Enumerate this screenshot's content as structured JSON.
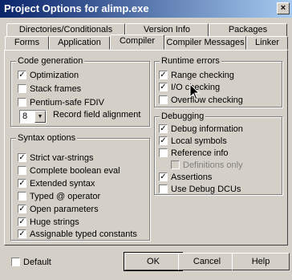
{
  "window": {
    "title": "Project Options for alimp.exe",
    "close_glyph": "×"
  },
  "tabs_back": [
    "Directories/Conditionals",
    "Version Info",
    "Packages"
  ],
  "tabs_front": [
    "Forms",
    "Application",
    "Compiler",
    "Compiler Messages",
    "Linker"
  ],
  "active_tab": "Compiler",
  "code_generation": {
    "title": "Code generation",
    "items": [
      {
        "label": "Optimization",
        "checked": true
      },
      {
        "label": "Stack frames",
        "checked": false
      },
      {
        "label": "Pentium-safe FDIV",
        "checked": false
      }
    ],
    "alignment": {
      "value": "8",
      "label": "Record field alignment"
    }
  },
  "syntax_options": {
    "title": "Syntax options",
    "items": [
      {
        "label": "Strict var-strings",
        "checked": true
      },
      {
        "label": "Complete boolean eval",
        "checked": false
      },
      {
        "label": "Extended syntax",
        "checked": true
      },
      {
        "label": "Typed @ operator",
        "checked": false
      },
      {
        "label": "Open parameters",
        "checked": true
      },
      {
        "label": "Huge strings",
        "checked": true
      },
      {
        "label": "Assignable typed constants",
        "checked": true
      }
    ]
  },
  "runtime_errors": {
    "title": "Runtime errors",
    "items": [
      {
        "label": "Range checking",
        "checked": true
      },
      {
        "label": "I/O checking",
        "checked": true
      },
      {
        "label": "Overflow checking",
        "checked": false
      }
    ]
  },
  "debugging": {
    "title": "Debugging",
    "items": [
      {
        "label": "Debug information",
        "checked": true,
        "disabled": false
      },
      {
        "label": "Local symbols",
        "checked": true,
        "disabled": false
      },
      {
        "label": "Reference info",
        "checked": false,
        "disabled": false
      },
      {
        "label": "Definitions only",
        "checked": false,
        "disabled": true
      },
      {
        "label": "Assertions",
        "checked": true,
        "disabled": false
      },
      {
        "label": "Use Debug DCUs",
        "checked": false,
        "disabled": false
      }
    ]
  },
  "footer": {
    "default_label": "Default",
    "default_checked": false,
    "ok": "OK",
    "cancel": "Cancel",
    "help": "Help"
  },
  "check_glyph": "✓"
}
